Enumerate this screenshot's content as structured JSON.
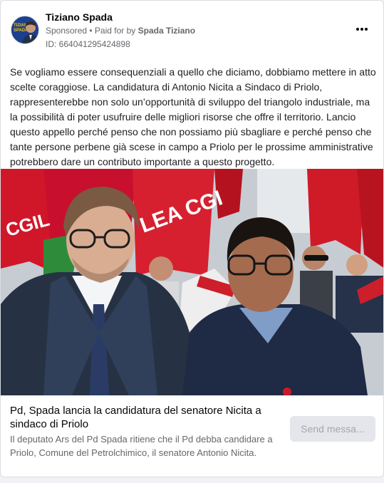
{
  "post": {
    "author": "Tiziano Spada",
    "avatar_text": "TIZIANO SPADA",
    "sponsored_label": "Sponsored",
    "paid_prefix": " • Paid for by ",
    "paid_by": "Spada Tiziano",
    "ad_id": "ID: 664041295424898",
    "more_icon": "more-horizontal-icon",
    "text": "Se vogliamo essere consequenziali a quello che diciamo, dobbiamo mettere in atto scelte coraggiose. La candidatura di Antonio Nicita a Sindaco di Priolo, rappresenterebbe non solo un’opportunità di sviluppo del triangolo industriale, ma la possibilità di poter usufruire delle migliori risorse che offre il territorio. Lancio questo appello perché penso che non possiamo più sbagliare e perché penso che tante persone perbene già scese in campo a Priolo per le prossime amministrative potrebbero dare un contributo importante a questo progetto."
  },
  "photo": {
    "flag_text_left": "CGIL",
    "flag_text_mid": "LEA CGI"
  },
  "link": {
    "headline": "Pd, Spada lancia la candidatura del senatore Nicita a sindaco di Priolo",
    "description": "Il deputato Ars del Pd Spada ritiene che il Pd debba candidare a Priolo, Comune del Petrolchimico, il senatore Antonio Nicita.",
    "cta": "Send messa..."
  },
  "colors": {
    "text_primary": "#050505",
    "text_secondary": "#65676b",
    "flag_red": "#d0172a",
    "cta_bg": "#e4e6eb"
  }
}
